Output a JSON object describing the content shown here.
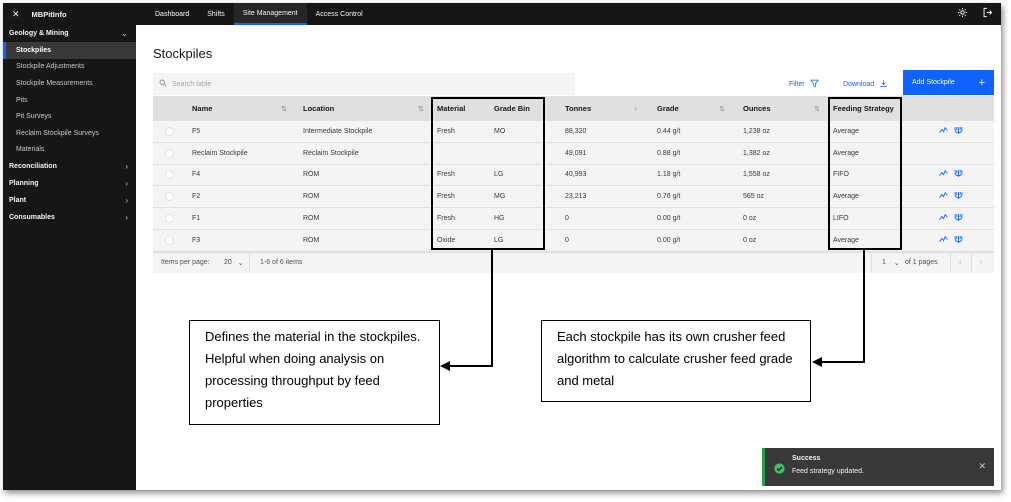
{
  "app": {
    "name": "MBPitInfo"
  },
  "sidebar": {
    "groups": [
      {
        "label": "Geology & Mining",
        "chevron": "⌄",
        "items": [
          "Stockpiles",
          "Stockpile Adjustments",
          "Stockpile Measurements",
          "Pits",
          "Pit Surveys",
          "Reclaim Stockpile Surveys",
          "Materials"
        ]
      },
      {
        "label": "Reconciliation",
        "chevron": "›"
      },
      {
        "label": "Planning",
        "chevron": "›"
      },
      {
        "label": "Plant",
        "chevron": "›"
      },
      {
        "label": "Consumables",
        "chevron": "›"
      }
    ],
    "active_item": "Stockpiles"
  },
  "topnav": {
    "tabs": [
      "Dashboard",
      "Shifts",
      "Site Management",
      "Access Control"
    ],
    "active": "Site Management"
  },
  "page": {
    "title": "Stockpiles",
    "search_placeholder": "Search table",
    "filter_label": "Filter",
    "download_label": "Download",
    "add_label": "Add Stockpile"
  },
  "table": {
    "columns": [
      "Name",
      "Location",
      "Material",
      "Grade Bin",
      "Tonnes",
      "Grade",
      "Ounces",
      "Feeding Strategy"
    ],
    "rows": [
      {
        "name": "F5",
        "location": "Intermediate Stockpile",
        "material": "Fresh",
        "grade_bin": "MO",
        "tonnes": "88,320",
        "grade": "0.44 g/t",
        "ounces": "1,238 oz",
        "strategy": "Average",
        "actions": true
      },
      {
        "name": "Reclaim Stockpile",
        "location": "Reclaim Stockpile",
        "material": "",
        "grade_bin": "",
        "tonnes": "49,091",
        "grade": "0.88 g/t",
        "ounces": "1,382 oz",
        "strategy": "Average",
        "actions": false
      },
      {
        "name": "F4",
        "location": "ROM",
        "material": "Fresh",
        "grade_bin": "LG",
        "tonnes": "40,993",
        "grade": "1.18 g/t",
        "ounces": "1,558 oz",
        "strategy": "FIFO",
        "actions": true
      },
      {
        "name": "F2",
        "location": "ROM",
        "material": "Fresh",
        "grade_bin": "MG",
        "tonnes": "23,213",
        "grade": "0.76 g/t",
        "ounces": "565 oz",
        "strategy": "Average",
        "actions": true
      },
      {
        "name": "F1",
        "location": "ROM",
        "material": "Fresh",
        "grade_bin": "HG",
        "tonnes": "0",
        "grade": "0.00 g/t",
        "ounces": "0 oz",
        "strategy": "LIFO",
        "actions": true
      },
      {
        "name": "F3",
        "location": "ROM",
        "material": "Oxide",
        "grade_bin": "LG",
        "tonnes": "0",
        "grade": "0.00 g/t",
        "ounces": "0 oz",
        "strategy": "Average",
        "actions": true
      }
    ],
    "pagination": {
      "items_per_page_label": "Items per page:",
      "items_per_page": "20",
      "range": "1-6 of 6 items",
      "page": "1",
      "pages": "of 1 pages"
    }
  },
  "annotations": {
    "left": "Defines the material in the stockpiles. Helpful when doing analysis on processing throughput by feed properties",
    "right": "Each stockpile has its own crusher feed algorithm to calculate crusher feed grade and metal"
  },
  "toast": {
    "title": "Success",
    "message": "Feed strategy updated."
  },
  "icons": {
    "close": "close-icon",
    "settings": "gear-icon",
    "logout": "logout-icon",
    "filter": "filter-icon",
    "download": "download-icon",
    "add": "plus-icon",
    "search": "search-icon",
    "check": "checkmark-icon"
  },
  "colors": {
    "accent": "#0f62fe",
    "sidebar": "#161616",
    "success": "#24a148"
  }
}
